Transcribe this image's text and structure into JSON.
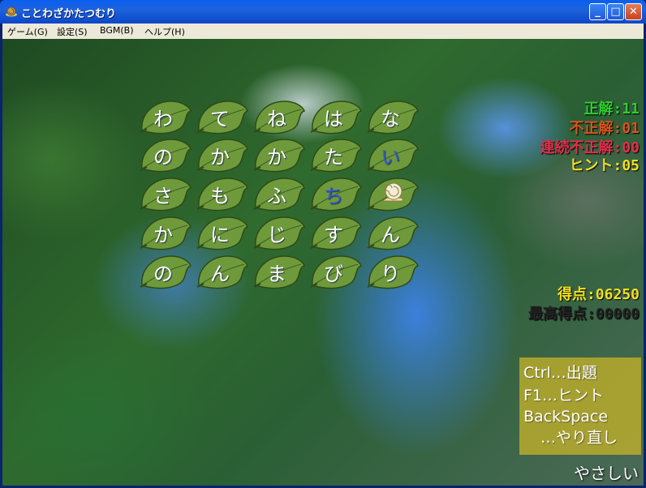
{
  "window": {
    "title": "ことわざかたつむり",
    "minimize": "_",
    "maximize": "□",
    "close": "✕"
  },
  "menu": [
    {
      "label": "ゲーム(G)"
    },
    {
      "label": "設定(S)"
    },
    {
      "label": "BGM(B)"
    },
    {
      "label": "ヘルプ(H)"
    }
  ],
  "grid": [
    [
      {
        "char": "わ"
      },
      {
        "char": "て"
      },
      {
        "char": "ね"
      },
      {
        "char": "は"
      },
      {
        "char": "な"
      }
    ],
    [
      {
        "char": "の"
      },
      {
        "char": "か"
      },
      {
        "char": "か"
      },
      {
        "char": "た"
      },
      {
        "char": "い",
        "style": "blue"
      }
    ],
    [
      {
        "char": "さ"
      },
      {
        "char": "も"
      },
      {
        "char": "ふ"
      },
      {
        "char": "ち",
        "style": "blue"
      },
      {
        "char": "",
        "snail": true
      }
    ],
    [
      {
        "char": "か"
      },
      {
        "char": "に"
      },
      {
        "char": "じ"
      },
      {
        "char": "す"
      },
      {
        "char": "ん"
      }
    ],
    [
      {
        "char": "の"
      },
      {
        "char": "ん"
      },
      {
        "char": "ま"
      },
      {
        "char": "び"
      },
      {
        "char": "り"
      }
    ]
  ],
  "stats": {
    "correct": "正解:11",
    "incorrect": "不正解:01",
    "consecutive_incorrect": "連続不正解:00",
    "hints": "ヒント:05",
    "score": "得点:06250",
    "high_score": "最高得点:00000"
  },
  "colors": {
    "correct": "#33cc33",
    "incorrect": "#d9541e",
    "consecutive_incorrect": "#e0304a",
    "hints": "#f0e020",
    "score": "#f0e020",
    "high_score": "#222222",
    "leaf": "#6f9a3c"
  },
  "help": {
    "line1": "Ctrl…出題",
    "line2": "F1…ヒント",
    "line3": "BackSpace",
    "line4": "…やり直し"
  },
  "difficulty": "やさしい",
  "icons": {
    "app": "snail-icon",
    "snail_piece": "snail-icon"
  }
}
